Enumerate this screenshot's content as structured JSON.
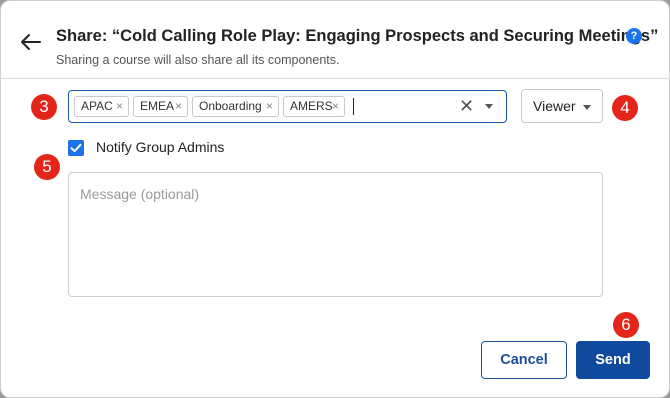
{
  "header": {
    "title": "Share: “Cold Calling Role Play: Engaging Prospects and Securing Meetings”",
    "subtitle": "Sharing a course will also share all its components.",
    "help_icon": "question-icon",
    "help_glyph": "?"
  },
  "recipients": {
    "tags": [
      {
        "label": "APAC"
      },
      {
        "label": "EMEA"
      },
      {
        "label": "Onboarding"
      },
      {
        "label": "AMERS"
      }
    ],
    "remove_glyph": "×",
    "clear_glyph": "✕",
    "input_value": ""
  },
  "role": {
    "selected": "Viewer"
  },
  "notify": {
    "label": "Notify Group Admins",
    "checked": true
  },
  "message": {
    "placeholder": "Message (optional)",
    "value": ""
  },
  "actions": {
    "cancel_label": "Cancel",
    "send_label": "Send"
  },
  "step_markers": [
    "3",
    "4",
    "5",
    "6"
  ],
  "colors": {
    "accent": "#1a73e8",
    "primary_button": "#0f4a9c",
    "marker": "#e32619"
  }
}
